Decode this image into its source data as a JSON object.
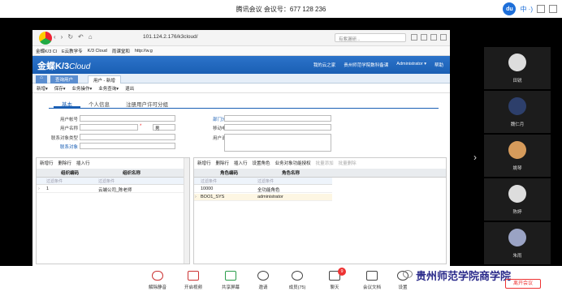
{
  "meeting": {
    "title": "腾讯会议 会议号：677 128 236"
  },
  "browser": {
    "url": "101.124.2.176/k3cloud/",
    "search_placeholder": "有紫漏研...",
    "bookmarks": [
      "金蝶K/3 Cl",
      "E云教学专",
      "K/3 Cloud",
      "雨课堂和",
      "http://w.g"
    ]
  },
  "k3": {
    "logo_main": "金蝶K/3",
    "logo_sub": "Cloud",
    "header_links": [
      "我的云之家",
      "贵州师范学院数科备课",
      "Administrator ▾",
      "帮助"
    ],
    "tabs": [
      "查询用户",
      "用户 - 新增"
    ],
    "menu": [
      "新增▾",
      "保存▾",
      "业务操作▾",
      "业务查询▾",
      "退出"
    ],
    "subtabs": [
      "基本",
      "个人信息",
      "注册用户许可分组"
    ],
    "fields": {
      "account_label": "用户帐号",
      "name_label": "用户名称",
      "gender_value": "男",
      "contact_type_label": "联系对象类型",
      "contact_label": "联系对象",
      "dept_label": "部门分组",
      "mobile_label": "移动电话",
      "desc_label": "用户说明"
    },
    "left_panel": {
      "toolbar": [
        "新增行",
        "删除行",
        "插入行"
      ],
      "columns": [
        "组织编码",
        "组织名称"
      ],
      "filter": [
        "过滤条件",
        "过滤条件"
      ],
      "rows": [
        [
          "1",
          "云端公司_陈老师"
        ]
      ]
    },
    "right_panel": {
      "toolbar": [
        "新增行",
        "删除行",
        "插入行",
        "设置角色",
        "业务对象功能授权"
      ],
      "toolbar_disabled": [
        "批量添加",
        "批量删除"
      ],
      "columns": [
        "角色编码",
        "角色名称"
      ],
      "filter": [
        "过滤条件",
        "过滤条件"
      ],
      "rows": [
        [
          "10000",
          "全功能角色"
        ],
        [
          "BOO1_SYS",
          "administrator"
        ]
      ]
    }
  },
  "participants": [
    "田锐",
    "魏仁月",
    "姚琴",
    "陈婷",
    "朱雨"
  ],
  "toolbar": {
    "items": [
      "解除静音",
      "开启视频",
      "共享屏幕",
      "邀请",
      "成员(75)",
      "聊天",
      "会议文档",
      "设置"
    ],
    "chat_badge": "9",
    "leave": "离开会议"
  },
  "watermark": "贵州师范学院商学院"
}
